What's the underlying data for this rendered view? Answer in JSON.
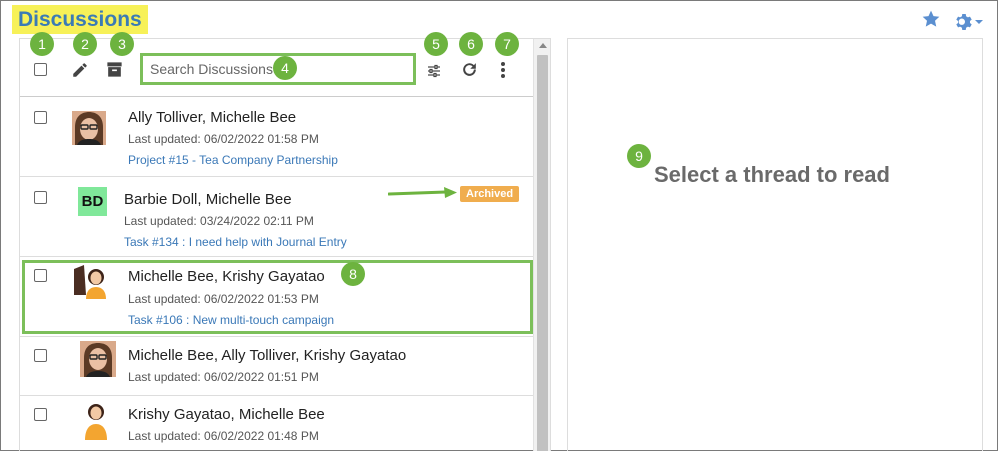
{
  "header": {
    "title": "Discussions",
    "star_icon": "star-icon",
    "settings_icon": "gear-icon"
  },
  "toolbar": {
    "select_all_icon": "checkbox",
    "compose_icon": "pencil-icon",
    "archive_icon": "archive-box-icon",
    "search_placeholder": "Search Discussions",
    "filter_icon": "sliders-icon",
    "refresh_icon": "refresh-icon",
    "more_icon": "vertical-dots-icon"
  },
  "threads": [
    {
      "names": "Ally Tolliver, Michelle Bee",
      "updated": "Last updated: 06/02/2022 01:58 PM",
      "link": "Project #15 - Tea Company Partnership"
    },
    {
      "names": "Barbie Doll, Michelle Bee",
      "updated": "Last updated: 03/24/2022 02:11 PM",
      "link": "Task #134 : I need help with Journal Entry",
      "badge": "Archived",
      "initials": "BD"
    },
    {
      "names": "Michelle Bee, Krishy Gayatao",
      "updated": "Last updated: 06/02/2022 01:53 PM",
      "link": "Task #106 : New multi-touch campaign"
    },
    {
      "names": "Michelle Bee, Ally Tolliver, Krishy Gayatao",
      "updated": "Last updated: 06/02/2022 01:51 PM"
    },
    {
      "names": "Krishy Gayatao, Michelle Bee",
      "updated": "Last updated: 06/02/2022 01:48 PM"
    }
  ],
  "reading_pane": {
    "placeholder": "Select a thread to read"
  },
  "annotations": [
    "1",
    "2",
    "3",
    "4",
    "5",
    "6",
    "7",
    "8",
    "9"
  ],
  "colors": {
    "accent": "#3b7bb5",
    "highlight_yellow": "#f7f158",
    "annotation_green": "#6db33f",
    "badge_orange": "#f0ad4e"
  }
}
